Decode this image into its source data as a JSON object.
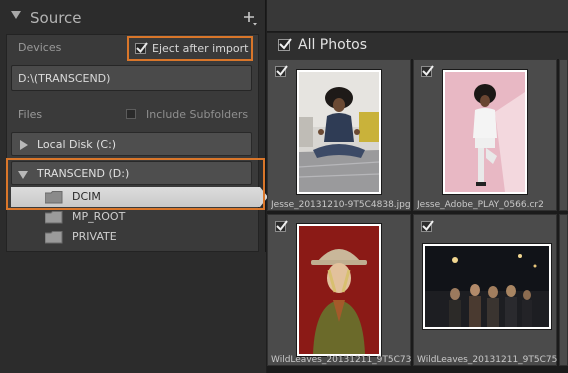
{
  "source_panel": {
    "title": "Source",
    "devices_label": "Devices",
    "eject_after_import": {
      "label": "Eject after import",
      "checked": true
    },
    "path_value": "D:\\(TRANSCEND)",
    "files_label": "Files",
    "include_subfolders": {
      "label": "Include Subfolders",
      "checked": false
    },
    "drives": [
      {
        "label": "Local Disk (C:)",
        "expanded": false
      },
      {
        "label": "TRANSCEND (D:)",
        "expanded": true
      }
    ],
    "folders": [
      {
        "label": "DCIM",
        "selected": true
      },
      {
        "label": "MP_ROOT",
        "selected": false
      },
      {
        "label": "PRIVATE",
        "selected": false
      }
    ]
  },
  "grid": {
    "header": {
      "label": "All Photos",
      "checked": true
    },
    "items": [
      {
        "filename": "Jesse_20131210-9T5C4838.jpg",
        "checked": true
      },
      {
        "filename": "Jesse_Adobe_PLAY_0566.cr2",
        "checked": true
      },
      {
        "filename": "WildLeaves_20131211_9T5C734...",
        "checked": true
      },
      {
        "filename": "WildLeaves_20131211_9T5C751...",
        "checked": true
      }
    ]
  },
  "colors": {
    "highlight_outline": "#d9762a",
    "panel_bg": "#2c2c2c",
    "cell_bg": "#4b4b4b"
  }
}
